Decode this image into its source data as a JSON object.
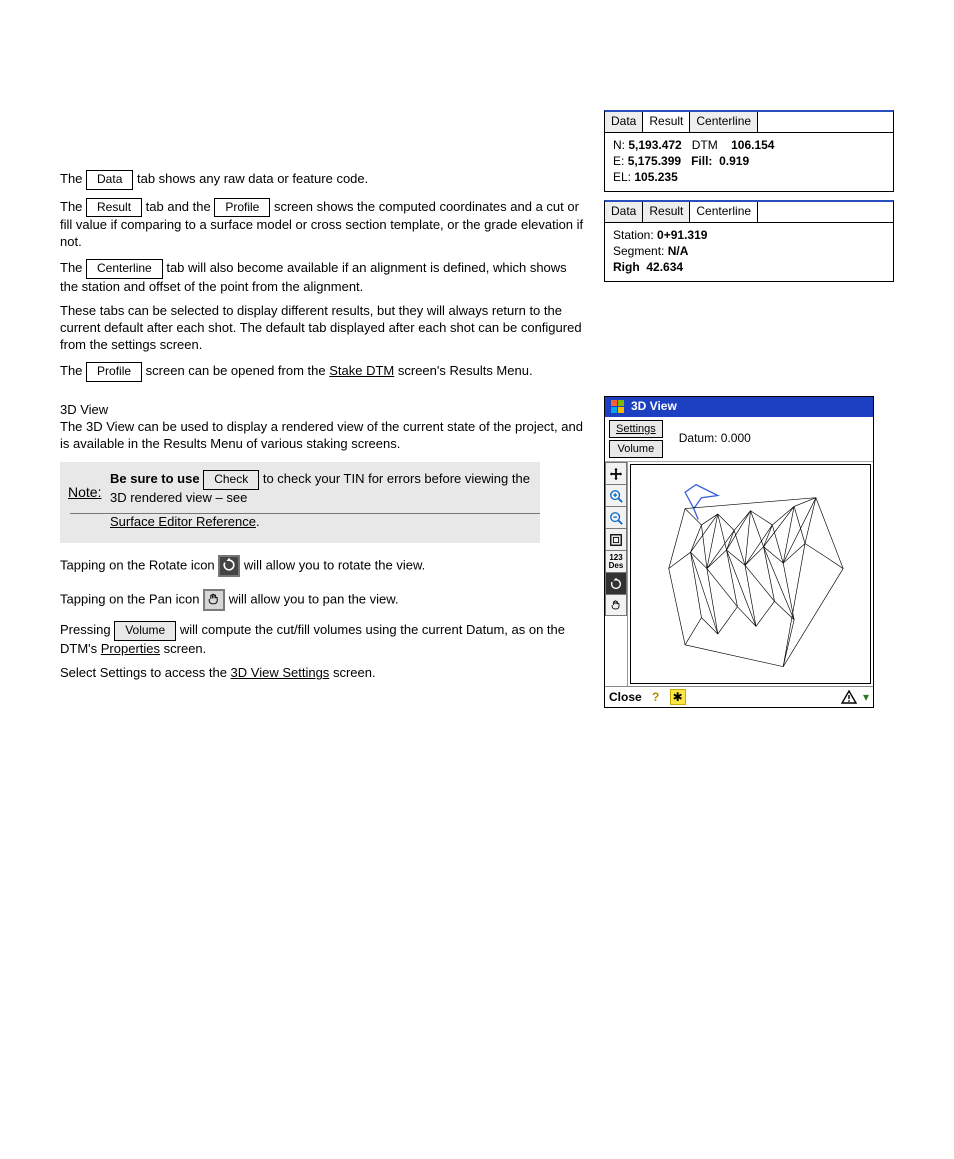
{
  "panel_result": {
    "tabs": [
      "Data",
      "Result",
      "Centerline"
    ],
    "active_tab_index": 1,
    "n_label": "N:",
    "n_val": "5,193.472",
    "dtm_label": "DTM",
    "dtm_val": "106.154",
    "e_label": "E:",
    "e_val": "5,175.399",
    "fill_label": "Fill:",
    "fill_val": "0.919",
    "el_label": "EL:",
    "el_val": "105.235"
  },
  "panel_centerline": {
    "tabs": [
      "Data",
      "Result",
      "Centerline"
    ],
    "active_tab_index": 2,
    "station_label": "Station:",
    "station_val": "0+91.319",
    "segment_label": "Segment:",
    "segment_val": "N/A",
    "righ_label": "Righ",
    "righ_val": "42.634"
  },
  "body": {
    "p1_pre": "The ",
    "p1_btn": "Data",
    "p1_post": " tab shows any raw data or feature code.",
    "p2_pre": "The ",
    "p2_btn": "Result",
    "p2_mid": " tab and the ",
    "p2_btn2": "Profile",
    "p2_post": " screen shows the computed coordinates and a cut or fill value if comparing to a surface model or cross section template, or the grade elevation if not.",
    "p3_pre": "The ",
    "p3_btn": "Centerline",
    "p3_post": " tab will also become available if an alignment is defined, which shows the station and offset of the point from the alignment.",
    "p4": "These tabs can be selected to display different results, but they will always return to the current default after each shot. The default tab displayed after each shot can be configured from the settings screen.",
    "p5_pre": "The ",
    "p5_btn": "Profile",
    "p5_mid": " screen can be opened from the ",
    "p5_link": "Stake DTM",
    "p5_post": " screen's Results Menu."
  },
  "threeD_intro": {
    "title": "3D View",
    "para": "The 3D View can be used to display a rendered view of the current state of the project, and is available in the Results Menu of various staking screens."
  },
  "note": {
    "label": "Note:",
    "pre": "Be sure to use ",
    "btn": "Check",
    "post": " to check your TIN for errors before viewing the 3D rendered view – see",
    "link": "Surface Editor Reference"
  },
  "rotate": {
    "text1": "Tapping on the Rotate icon ",
    "text2": " will allow you to rotate the view."
  },
  "pan": {
    "text1": "Tapping on the Pan icon ",
    "text2": " will allow you to pan the view."
  },
  "volume": {
    "pre": "Pressing ",
    "btn": "Volume",
    "mid": " will compute the cut/fill volumes using the current Datum, as on the DTM's ",
    "link": "Properties",
    "post": " screen."
  },
  "settings_line": {
    "pre": "Select Settings to access the ",
    "link": "3D View Settings",
    "post": " screen."
  },
  "win3d": {
    "title": "3D View",
    "settings_btn": "Settings",
    "volume_btn": "Volume",
    "datum_text": "Datum: 0.000",
    "close": "Close",
    "tools": {
      "move": "move-tool",
      "zoom_in": "zoom-in-tool",
      "zoom_out": "zoom-out-tool",
      "extents": "zoom-extents-tool",
      "info": "info-tool",
      "rotate": "rotate-tool",
      "pan": "pan-tool"
    }
  }
}
